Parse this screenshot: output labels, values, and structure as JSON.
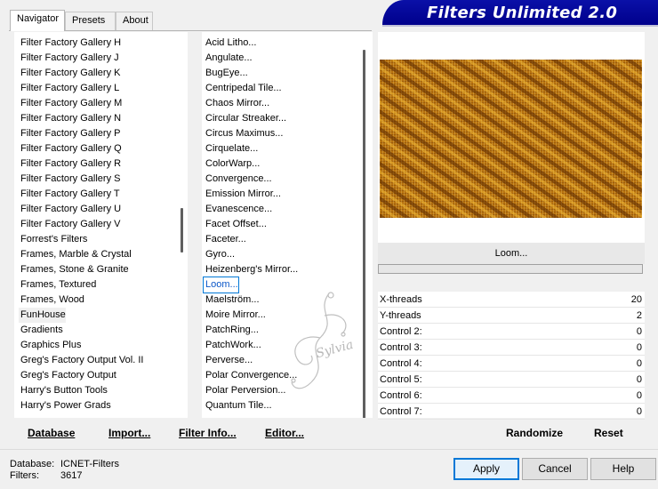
{
  "tabs": [
    "Navigator",
    "Presets",
    "About"
  ],
  "banner_title": "Filters Unlimited 2.0",
  "categories": [
    "Filter Factory Gallery H",
    "Filter Factory Gallery J",
    "Filter Factory Gallery K",
    "Filter Factory Gallery L",
    "Filter Factory Gallery M",
    "Filter Factory Gallery N",
    "Filter Factory Gallery P",
    "Filter Factory Gallery Q",
    "Filter Factory Gallery R",
    "Filter Factory Gallery S",
    "Filter Factory Gallery T",
    "Filter Factory Gallery U",
    "Filter Factory Gallery V",
    "Forrest's Filters",
    "Frames, Marble & Crystal",
    "Frames, Stone & Granite",
    "Frames, Textured",
    "Frames, Wood",
    "FunHouse",
    "Gradients",
    "Graphics Plus",
    "Greg's Factory Output Vol. II",
    "Greg's Factory Output",
    "Harry's Button Tools",
    "Harry's Power Grads"
  ],
  "selected_category": "FunHouse",
  "filters": [
    "Acid Litho...",
    "Angulate...",
    "BugEye...",
    "Centripedal Tile...",
    "Chaos Mirror...",
    "Circular Streaker...",
    "Circus Maximus...",
    "Cirquelate...",
    "ColorWarp...",
    "Convergence...",
    "Emission Mirror...",
    "Evanescence...",
    "Facet Offset...",
    "Faceter...",
    "Gyro...",
    "Heizenberg's Mirror...",
    "Loom...",
    "Maelström...",
    "Moire Mirror...",
    "PatchRing...",
    "PatchWork...",
    "Perverse...",
    "Polar Convergence...",
    "Polar Perversion...",
    "Quantum Tile..."
  ],
  "selected_filter": "Loom...",
  "preview_filter_name": "Loom...",
  "progress": 0,
  "params": [
    {
      "label": "X-threads",
      "value": "20"
    },
    {
      "label": "Y-threads",
      "value": "2"
    },
    {
      "label": "Control 2:",
      "value": "0"
    },
    {
      "label": "Control 3:",
      "value": "0"
    },
    {
      "label": "Control 4:",
      "value": "0"
    },
    {
      "label": "Control 5:",
      "value": "0"
    },
    {
      "label": "Control 6:",
      "value": "0"
    },
    {
      "label": "Control 7:",
      "value": "0"
    }
  ],
  "buttons": {
    "database": "Database",
    "import": "Import...",
    "filter_info": "Filter Info...",
    "editor": "Editor...",
    "randomize": "Randomize",
    "reset": "Reset",
    "apply": "Apply",
    "cancel": "Cancel",
    "help": "Help"
  },
  "status": {
    "database_label": "Database:",
    "database_value": "ICNET-Filters",
    "filters_label": "Filters:",
    "filters_value": "3617"
  },
  "watermark_text": "Sylvia",
  "colors": {
    "banner": "#00008c",
    "selection": "#0078d7",
    "preview_base": "#b8720e"
  }
}
